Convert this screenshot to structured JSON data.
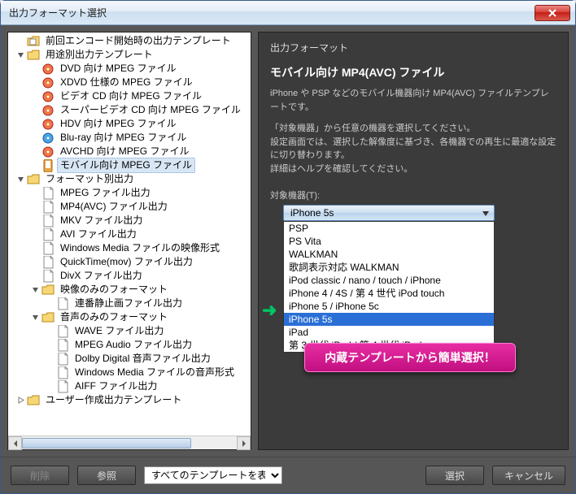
{
  "window": {
    "title": "出力フォーマット選択"
  },
  "tree": [
    {
      "depth": 0,
      "twisty": "none",
      "icon": "folder-doc",
      "label": "前回エンコード開始時の出力テンプレート"
    },
    {
      "depth": 0,
      "twisty": "open",
      "icon": "folder",
      "label": "用途別出力テンプレート"
    },
    {
      "depth": 1,
      "twisty": "none",
      "icon": "disc-red",
      "label": "DVD 向け MPEG ファイル"
    },
    {
      "depth": 1,
      "twisty": "none",
      "icon": "disc-red",
      "label": "XDVD 仕様の MPEG ファイル"
    },
    {
      "depth": 1,
      "twisty": "none",
      "icon": "disc-red",
      "label": "ビデオ CD 向け MPEG ファイル"
    },
    {
      "depth": 1,
      "twisty": "none",
      "icon": "disc-red",
      "label": "スーパービデオ CD 向け MPEG ファイル"
    },
    {
      "depth": 1,
      "twisty": "none",
      "icon": "disc-red",
      "label": "HDV 向け MPEG ファイル"
    },
    {
      "depth": 1,
      "twisty": "none",
      "icon": "disc-blue",
      "label": "Blu-ray 向け MPEG ファイル"
    },
    {
      "depth": 1,
      "twisty": "none",
      "icon": "disc-red",
      "label": "AVCHD 向け MPEG ファイル"
    },
    {
      "depth": 1,
      "twisty": "none",
      "icon": "mobile",
      "label": "モバイル向け MPEG ファイル",
      "selected": true
    },
    {
      "depth": 0,
      "twisty": "open",
      "icon": "folder",
      "label": "フォーマット別出力"
    },
    {
      "depth": 1,
      "twisty": "none",
      "icon": "file",
      "label": "MPEG ファイル出力"
    },
    {
      "depth": 1,
      "twisty": "none",
      "icon": "file",
      "label": "MP4(AVC) ファイル出力"
    },
    {
      "depth": 1,
      "twisty": "none",
      "icon": "file",
      "label": "MKV ファイル出力"
    },
    {
      "depth": 1,
      "twisty": "none",
      "icon": "file",
      "label": "AVI ファイル出力"
    },
    {
      "depth": 1,
      "twisty": "none",
      "icon": "file",
      "label": "Windows Media ファイルの映像形式"
    },
    {
      "depth": 1,
      "twisty": "none",
      "icon": "file",
      "label": "QuickTime(mov) ファイル出力"
    },
    {
      "depth": 1,
      "twisty": "none",
      "icon": "file",
      "label": "DivX ファイル出力"
    },
    {
      "depth": 1,
      "twisty": "open",
      "icon": "folder",
      "label": "映像のみのフォーマット"
    },
    {
      "depth": 2,
      "twisty": "none",
      "icon": "file",
      "label": "連番静止画ファイル出力"
    },
    {
      "depth": 1,
      "twisty": "open",
      "icon": "folder",
      "label": "音声のみのフォーマット"
    },
    {
      "depth": 2,
      "twisty": "none",
      "icon": "file",
      "label": "WAVE ファイル出力"
    },
    {
      "depth": 2,
      "twisty": "none",
      "icon": "file",
      "label": "MPEG Audio ファイル出力"
    },
    {
      "depth": 2,
      "twisty": "none",
      "icon": "file",
      "label": "Dolby Digital 音声ファイル出力"
    },
    {
      "depth": 2,
      "twisty": "none",
      "icon": "file",
      "label": "Windows Media ファイルの音声形式"
    },
    {
      "depth": 2,
      "twisty": "none",
      "icon": "file",
      "label": "AIFF ファイル出力"
    },
    {
      "depth": 0,
      "twisty": "closed",
      "icon": "folder",
      "label": "ユーザー作成出力テンプレート"
    }
  ],
  "right": {
    "section": "出力フォーマット",
    "format_name": "モバイル向け MP4(AVC) ファイル",
    "desc": "iPhone や PSP などのモバイル機器向け MP4(AVC) ファイルテンプレートです。",
    "instr": "「対象機器」から任意の機器を選択してください。\n設定画面では、選択した解像度に基づき、各機器での再生に最適な設定に切り替わります。\n詳細はヘルプを確認してください。",
    "field_label": "対象機器(T):",
    "selected_value": "iPhone 5s",
    "options": [
      "PSP",
      "PS Vita",
      "WALKMAN",
      "歌詞表示対応 WALKMAN",
      "iPod classic / nano / touch / iPhone",
      "iPhone 4 / 4S / 第 4 世代 iPod touch",
      "iPhone 5 / iPhone 5c",
      "iPhone 5s",
      "iPad",
      "第 3 世代 iPad / 第 4 世代 iPad"
    ],
    "highlight_option": "iPhone 5s",
    "promo": "内蔵テンプレートから簡単選択！"
  },
  "buttons": {
    "delete": "削除",
    "browse": "参照",
    "filter": "すべてのテンプレートを表示",
    "select": "選択",
    "cancel": "キャンセル"
  }
}
